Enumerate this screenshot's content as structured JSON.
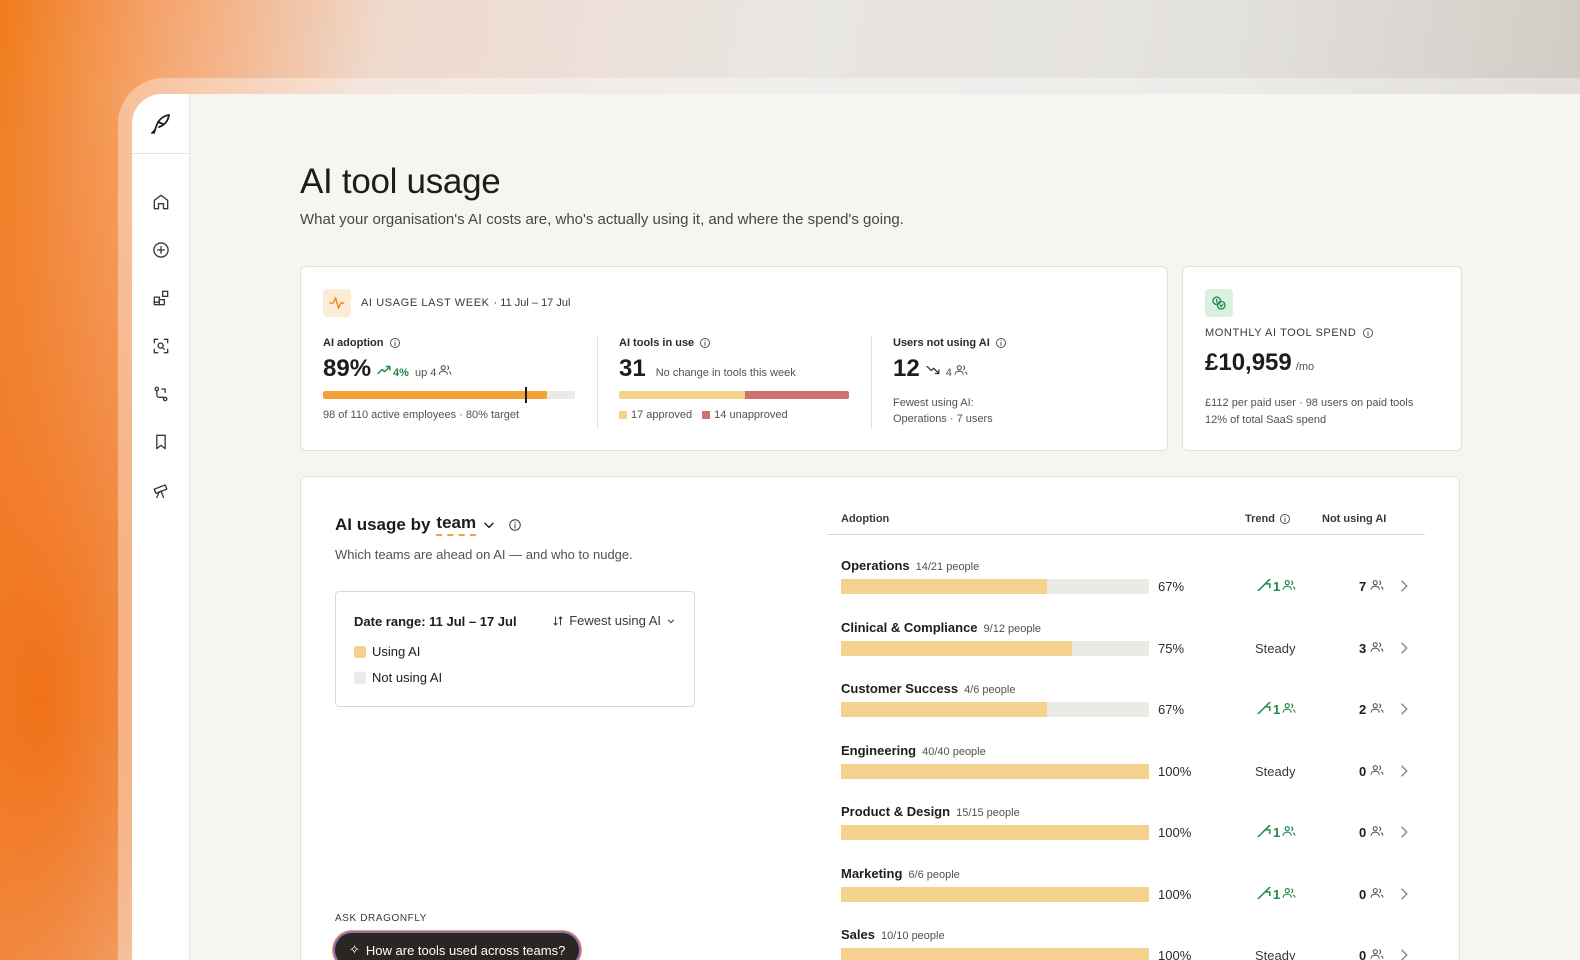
{
  "page": {
    "title": "AI tool usage",
    "subtitle": "What your organisation's AI costs are, who's actually using it, and where the spend's going."
  },
  "sidebar": {
    "items": [
      {
        "icon": "home-icon"
      },
      {
        "icon": "chat-plus-icon"
      },
      {
        "icon": "apps-icon"
      },
      {
        "icon": "scan-search-icon"
      },
      {
        "icon": "workflow-icon"
      },
      {
        "icon": "bookmark-icon"
      },
      {
        "icon": "telescope-icon"
      }
    ]
  },
  "usage_card": {
    "heading": "AI USAGE LAST WEEK",
    "date_range": "· 11 Jul – 17 Jul",
    "adoption": {
      "label": "AI adoption",
      "value": "89%",
      "delta": "4%",
      "delta_people": "up 4",
      "fill_fraction": 0.89,
      "target_fraction": 0.8,
      "caption": "98 of 110 active employees · 80% target"
    },
    "tools": {
      "label": "AI tools in use",
      "value": "31",
      "note": "No change in tools this week",
      "approved": 17,
      "unapproved": 14,
      "approved_label": "17 approved",
      "unapproved_label": "14 unapproved"
    },
    "not_using": {
      "label": "Users not using AI",
      "value": "12",
      "delta": "4",
      "fewest_label": "Fewest using AI:",
      "fewest_value": "Operations · 7 users"
    }
  },
  "spend_card": {
    "heading": "MONTHLY AI TOOL SPEND",
    "value": "£10,959",
    "unit": "/mo",
    "line1": "£112 per paid user · 98 users on paid tools",
    "line2": "12% of total SaaS spend"
  },
  "team_section": {
    "title_prefix": "AI usage by",
    "title_group": "team",
    "subtitle": "Which teams are ahead on AI — and who to nudge.",
    "filter": {
      "date_label": "Date range: 11 Jul – 17 Jul",
      "sort_label": "Fewest using AI",
      "legend_using": "Using AI",
      "legend_not_using": "Not using AI"
    },
    "ask": {
      "label": "ASK DRAGONFLY",
      "prompt": "How are tools used across teams?"
    },
    "columns": {
      "adoption": "Adoption",
      "trend": "Trend",
      "not_using": "Not using AI"
    },
    "rows": [
      {
        "name": "Operations",
        "people": "14/21 people",
        "pct": "67%",
        "fraction": 0.67,
        "trend": "1",
        "trend_type": "up",
        "not_using": "7"
      },
      {
        "name": "Clinical & Compliance",
        "people": "9/12 people",
        "pct": "75%",
        "fraction": 0.75,
        "trend": "Steady",
        "trend_type": "steady",
        "not_using": "3"
      },
      {
        "name": "Customer Success",
        "people": "4/6 people",
        "pct": "67%",
        "fraction": 0.67,
        "trend": "1",
        "trend_type": "up",
        "not_using": "2"
      },
      {
        "name": "Engineering",
        "people": "40/40 people",
        "pct": "100%",
        "fraction": 1.0,
        "trend": "Steady",
        "trend_type": "steady",
        "not_using": "0"
      },
      {
        "name": "Product & Design",
        "people": "15/15 people",
        "pct": "100%",
        "fraction": 1.0,
        "trend": "1",
        "trend_type": "up",
        "not_using": "0"
      },
      {
        "name": "Marketing",
        "people": "6/6 people",
        "pct": "100%",
        "fraction": 1.0,
        "trend": "1",
        "trend_type": "up",
        "not_using": "0"
      },
      {
        "name": "Sales",
        "people": "10/10 people",
        "pct": "100%",
        "fraction": 1.0,
        "trend": "Steady",
        "trend_type": "steady",
        "not_using": "0"
      }
    ]
  },
  "colors": {
    "accent_orange": "#f4a13a",
    "using_fill": "#f4d18d",
    "unapproved": "#cf6f6f",
    "trend_up": "#1f8a4c"
  }
}
